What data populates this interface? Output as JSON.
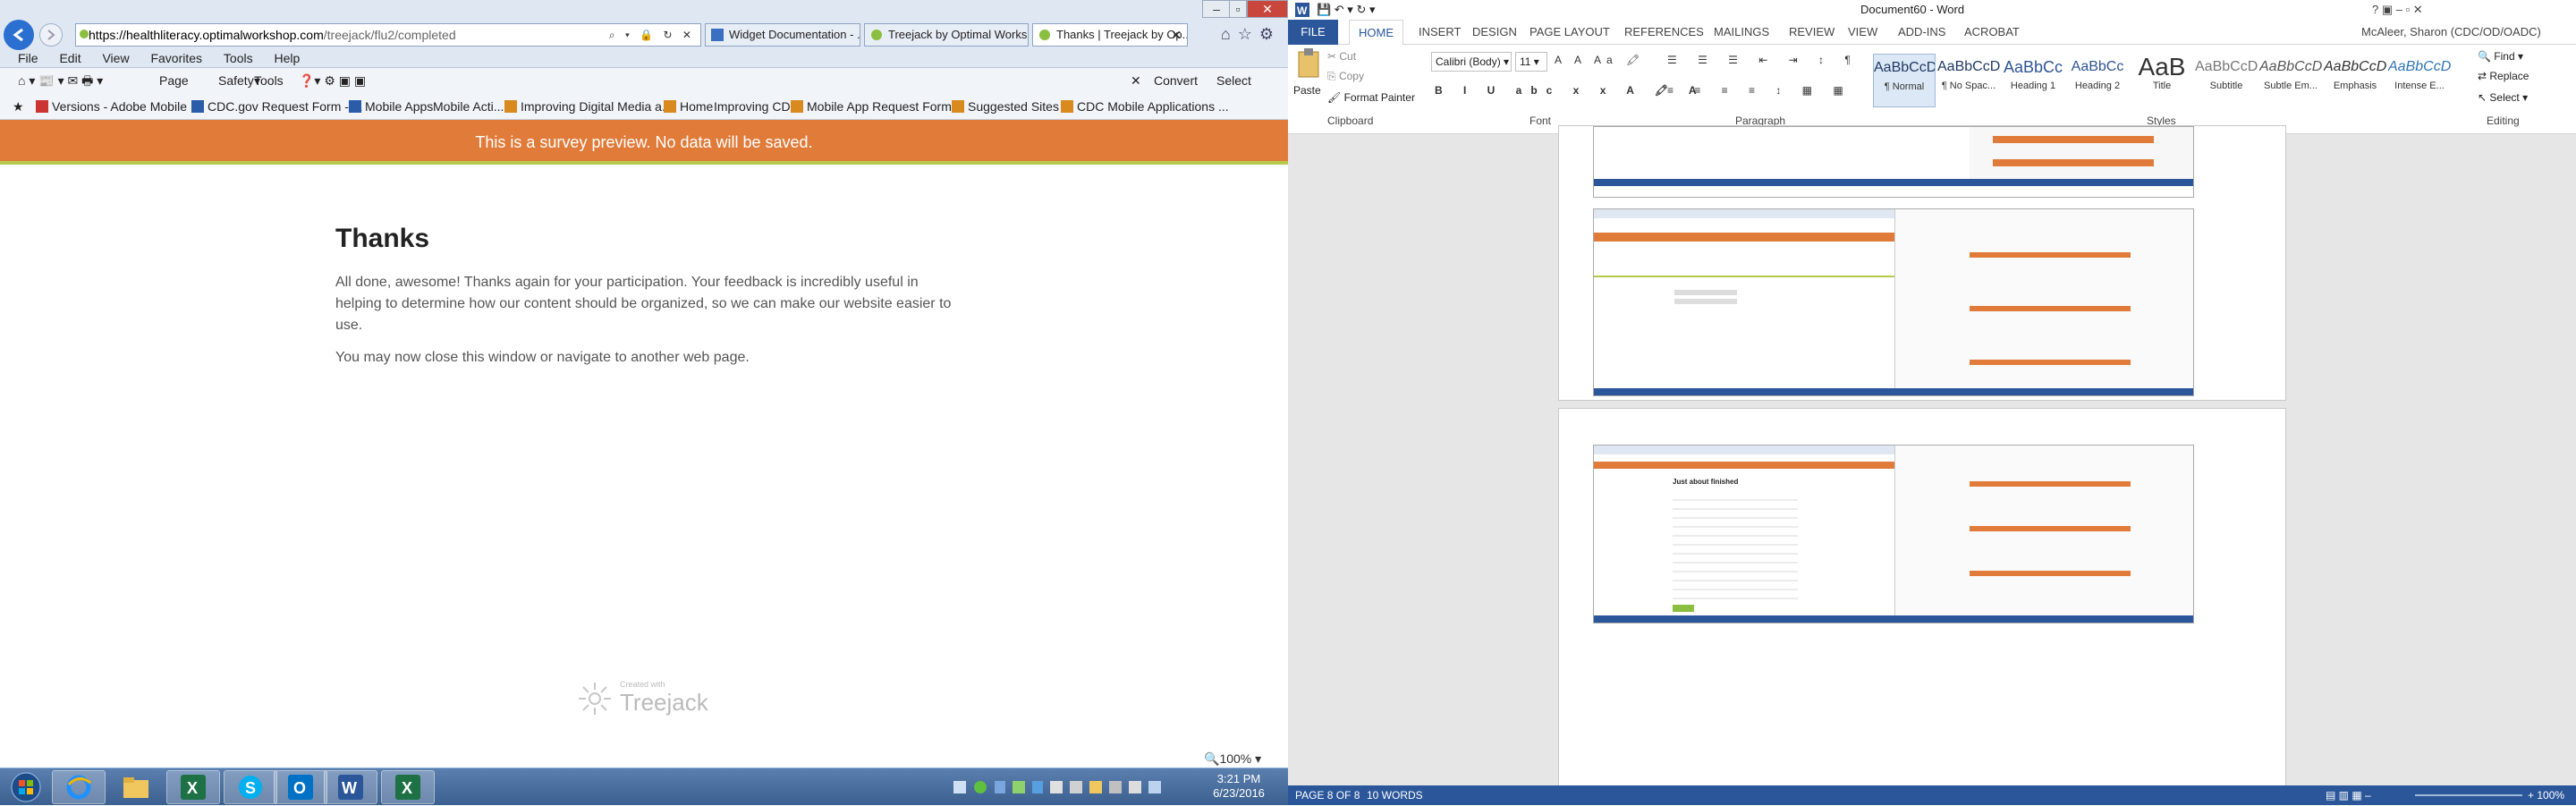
{
  "browser": {
    "url_domain": "https://healthliteracy.optimalworkshop.com",
    "url_path": "/treejack/flu2/completed",
    "tabs": [
      {
        "label": "Widget Documentation - ..."
      },
      {
        "label": "Treejack by Optimal Works..."
      },
      {
        "label": "Thanks | Treejack by Op..."
      }
    ],
    "menu": [
      "File",
      "Edit",
      "View",
      "Favorites",
      "Tools",
      "Help"
    ],
    "commands": {
      "page": "Page",
      "safety": "Safety",
      "tools": "Tools",
      "convert": "Convert",
      "select": "Select"
    },
    "favorites": [
      "Versions - Adobe Mobile ...",
      "CDC.gov Request Form - ...",
      "Mobile Apps",
      "Mobile Acti...",
      "Improving Digital Media a...",
      "Home",
      "Improving CDC",
      "Mobile App Request Form...",
      "Suggested Sites",
      "CDC Mobile Applications ..."
    ],
    "zoom": "100%"
  },
  "survey": {
    "banner": "This is a survey preview. No data will be saved.",
    "title": "Thanks",
    "body": "All done, awesome! Thanks again for your participation. Your feedback is incredibly useful in helping to determine how our content should be organized, so we can make our website easier to use.",
    "close_note": "You may now close this window or navigate to another web page.",
    "created_with": "Created with",
    "brand": "Treejack"
  },
  "word": {
    "title": "Document60 - Word",
    "user": "McAleer, Sharon (CDC/OD/OADC)",
    "tabs": [
      "FILE",
      "HOME",
      "INSERT",
      "DESIGN",
      "PAGE LAYOUT",
      "REFERENCES",
      "MAILINGS",
      "REVIEW",
      "VIEW",
      "ADD-INS",
      "ACROBAT"
    ],
    "clipboard": {
      "paste": "Paste",
      "cut": "Cut",
      "copy": "Copy",
      "format_painter": "Format Painter",
      "label": "Clipboard"
    },
    "font": {
      "name": "Calibri (Body)",
      "size": "11",
      "label": "Font"
    },
    "paragraph_label": "Paragraph",
    "styles_label": "Styles",
    "editing": {
      "find": "Find",
      "replace": "Replace",
      "select": "Select",
      "label": "Editing"
    },
    "styles": [
      {
        "sample": "AaBbCcDc",
        "name": "¶ Normal"
      },
      {
        "sample": "AaBbCcDc",
        "name": "¶ No Spac..."
      },
      {
        "sample": "AaBbCc",
        "name": "Heading 1"
      },
      {
        "sample": "AaBbCc",
        "name": "Heading 2"
      },
      {
        "sample": "AaB",
        "name": "Title"
      },
      {
        "sample": "AaBbCcD",
        "name": "Subtitle"
      },
      {
        "sample": "AaBbCcDc",
        "name": "Subtle Em..."
      },
      {
        "sample": "AaBbCcDc",
        "name": "Emphasis"
      },
      {
        "sample": "AaBbCcDc",
        "name": "Intense E..."
      }
    ],
    "status": {
      "page": "PAGE 8 OF 8",
      "words": "10 WORDS",
      "zoom": "100%"
    },
    "thumb_heading": "Just about finished"
  },
  "taskbar": {
    "time": "3:21 PM",
    "date": "6/23/2016"
  },
  "colors": {
    "banner": "#e07b39",
    "banner_border": "#b7c94b",
    "word_blue": "#2b579a",
    "taskbar": "#3b5f8e"
  }
}
